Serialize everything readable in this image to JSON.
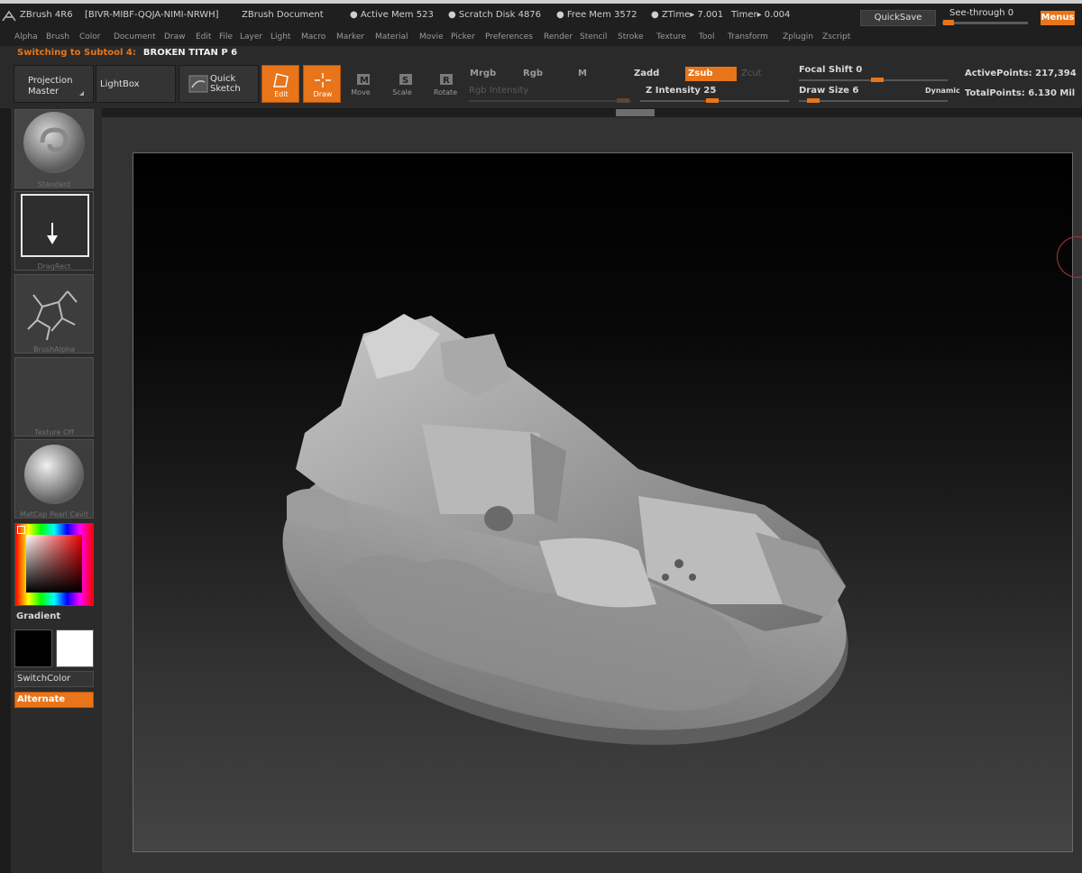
{
  "titlebar": {
    "app": "ZBrush  4R6",
    "serial": "[BIVR-MIBF-QQJA-NIMI-NRWH]",
    "document": "ZBrush  Document",
    "active_mem": "● Active  Mem  523",
    "scratch_disk": "● Scratch  Disk  4876",
    "free_mem": "● Free  Mem  3572",
    "ztime": "● ZTime▸ 7.001",
    "timer": "Timer▸ 0.004",
    "quicksave": "QuickSave",
    "see_through": "See-through   0",
    "menus": "Menus"
  },
  "menubar": [
    "Alpha",
    "Brush",
    "Color",
    "Document",
    "Draw",
    "Edit",
    "File",
    "Layer",
    "Light",
    "Macro",
    "Marker",
    "Material",
    "Movie",
    "Picker",
    "Preferences",
    "Render",
    "Stencil",
    "Stroke",
    "Texture",
    "Tool",
    "Transform",
    "Zplugin",
    "Zscript"
  ],
  "notice": {
    "label": "Switching to Subtool 4:",
    "name": "BROKEN TITAN P 6"
  },
  "toolbar": {
    "projection_master": [
      "Projection",
      "Master"
    ],
    "lightbox": "LightBox",
    "quick_sketch": [
      "Quick",
      "Sketch"
    ],
    "edit": "Edit",
    "draw": "Draw",
    "move": "Move",
    "scale": "Scale",
    "rotate": "Rotate",
    "mrgb": "Mrgb",
    "rgb": "Rgb",
    "m": "M",
    "rgb_intensity": "Rgb  Intensity",
    "zadd": "Zadd",
    "zsub": "Zsub",
    "zcut": "Zcut",
    "z_intensity": "Z  Intensity  25",
    "focal_shift": "Focal  Shift  0",
    "draw_size": "Draw  Size  6",
    "dynamic": "Dynamic",
    "active_points": "ActivePoints:  217,394",
    "total_points": "TotalPoints:  6.130  Mil"
  },
  "left_panel": {
    "brush": "Standard",
    "stroke": "DragRect",
    "alpha": "BrushAlpha",
    "texture": "Texture  Off",
    "material": "MatCap  Pearl  Cavit",
    "gradient": "Gradient",
    "switch_color": "SwitchColor",
    "alternate": "Alternate"
  },
  "colors": {
    "accent": "#e8751a",
    "panel": "#2b2b2b",
    "canvas_top": "#000000",
    "canvas_bottom": "#444444"
  },
  "icons": [
    "zbrush-logo-icon",
    "edit-icon",
    "draw-icon",
    "move-icon",
    "scale-icon",
    "rotate-icon",
    "down-arrow-icon",
    "sphere-icon"
  ]
}
